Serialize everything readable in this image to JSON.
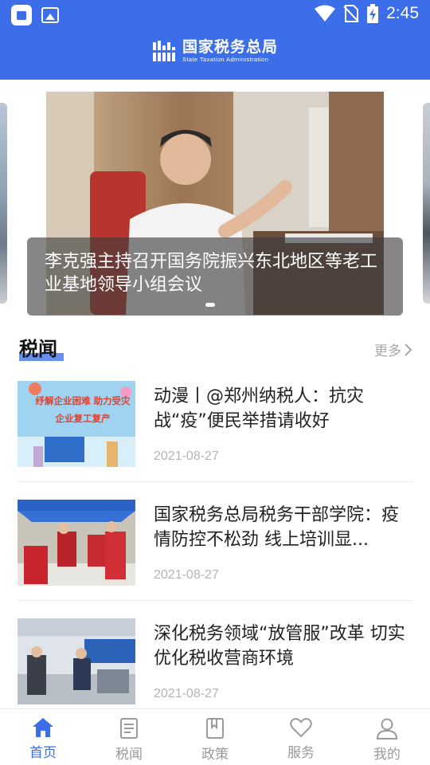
{
  "status_bar": {
    "time": "2:45",
    "left_icons": [
      "app-notification-icon",
      "image-icon"
    ],
    "right_icons": [
      "wifi-icon",
      "no-sim-icon",
      "battery-charging-icon"
    ]
  },
  "header": {
    "title_cn": "国家税务总局",
    "title_en": "State Taxation Administration",
    "background": "#3c6ee9"
  },
  "carousel": {
    "caption": "李克强主持召开国务院振兴东北地区等老工业基地领导小组会议",
    "indicator_count": 1
  },
  "section": {
    "title": "税闻",
    "more_label": "更多"
  },
  "news": [
    {
      "title": "动漫丨@郑州纳税人：抗灾战“疫”便民举措请收好",
      "date": "2021-08-27",
      "thumb_text": "纾解企业困难 助力受灾企业复工复产"
    },
    {
      "title": "国家税务总局税务干部学院：疫情防控不松劲 线上培训显...",
      "date": "2021-08-27"
    },
    {
      "title": "深化税务领域“放管服”改革 切实优化税收营商环境",
      "date": "2021-08-27"
    }
  ],
  "bottom_nav": [
    {
      "label": "首页",
      "icon": "home-icon",
      "active": true
    },
    {
      "label": "税闻",
      "icon": "news-icon",
      "active": false
    },
    {
      "label": "政策",
      "icon": "book-icon",
      "active": false
    },
    {
      "label": "服务",
      "icon": "heart-icon",
      "active": false
    },
    {
      "label": "我的",
      "icon": "user-icon",
      "active": false
    }
  ],
  "colors": {
    "accent": "#3c6ee9",
    "muted": "#9a9a9a"
  }
}
